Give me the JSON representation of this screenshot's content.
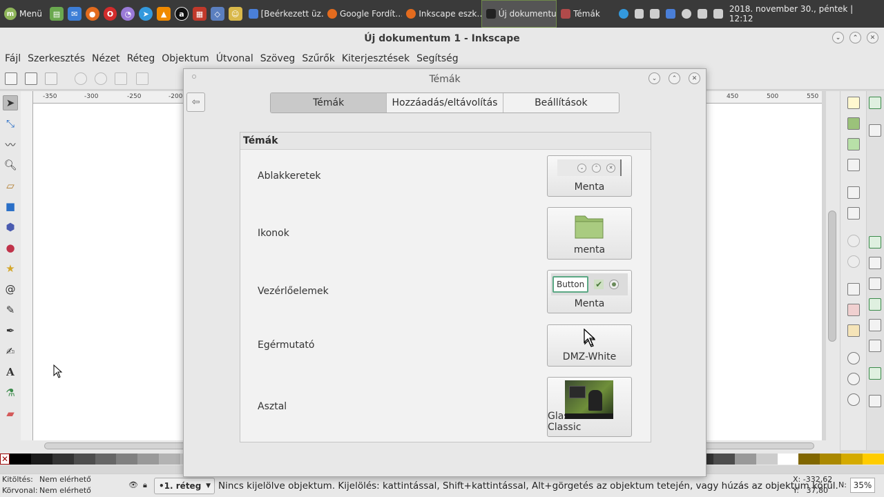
{
  "panel": {
    "menu_label": "Menü",
    "tasks": [
      {
        "label": "[Beérkezett üz…",
        "color": "#4a7fd8"
      },
      {
        "label": "Google Fordít…",
        "color": "#e36b1e"
      },
      {
        "label": "Inkscape eszk…",
        "color": "#e36b1e"
      },
      {
        "label": "Új dokumentu…",
        "color": "#222222"
      },
      {
        "label": "Témák",
        "color": "#b04a4a"
      }
    ],
    "clock": "2018. november 30., péntek | 12:12"
  },
  "window": {
    "title": "Új dokumentum 1 - Inkscape"
  },
  "menubar": [
    "Fájl",
    "Szerkesztés",
    "Nézet",
    "Réteg",
    "Objektum",
    "Útvonal",
    "Szöveg",
    "Szűrők",
    "Kiterjesztések",
    "Segítség"
  ],
  "ruler": {
    "left_ticks": [
      "-350",
      "-300",
      "-250",
      "-200"
    ],
    "right_ticks": [
      "450",
      "500",
      "550"
    ]
  },
  "dialog": {
    "title": "Témák",
    "tabs": [
      "Témák",
      "Hozzáadás/eltávolítás",
      "Beállítások"
    ],
    "section_title": "Témák",
    "rows": [
      {
        "label": "Ablakkeretek",
        "value": "Menta"
      },
      {
        "label": "Ikonok",
        "value": "menta"
      },
      {
        "label": "Vezérlőelemek",
        "value": "Menta",
        "preview_button": "Button"
      },
      {
        "label": "Egérmutató",
        "value": "DMZ-White"
      },
      {
        "label": "Asztal",
        "value": "Glass-Mint-Classic"
      }
    ]
  },
  "status": {
    "fill_label": "Kitöltés:",
    "stroke_label": "Körvonal:",
    "fill_value": "Nem elérhető",
    "stroke_value": "Nem elérhető",
    "layer": "•1. réteg",
    "message": "Nincs kijelölve objektum. Kijelölés: kattintással, Shift+kattintással, Alt+görgetés az objektum tetején, vagy húzás az objektum körül.",
    "x": "X: -332,62",
    "y": "Y:   37,80",
    "zoom_label": "N:",
    "zoom": "35%"
  },
  "colors": {
    "accent": "#8fb65a",
    "panel": "#3a3a3a"
  },
  "palette": [
    "#000000",
    "#1a1a1a",
    "#333333",
    "#4d4d4d",
    "#666666",
    "#808080",
    "#999999",
    "#b3b3b3",
    "#cccccc",
    "#e6e6e6",
    "#f2f2f2",
    "#ffffff",
    "#800000",
    "#ff0000",
    "#808000",
    "#c87137",
    "#d38d5f",
    "#deaa87",
    "#e9c6af",
    "#f4e3d7",
    "#2b1100",
    "#552200",
    "#803300",
    "#aa4400",
    "#d45500",
    "#ff6600",
    "#ff7f2a",
    "#ff9955",
    "#ffb380",
    "#ffccaa",
    "#ffe6d5",
    "#1a1a1a",
    "#333333",
    "#4d4d4d",
    "#999999",
    "#cccccc",
    "#ffffff",
    "#806600",
    "#aa8800",
    "#d4aa00",
    "#ffcc00"
  ]
}
